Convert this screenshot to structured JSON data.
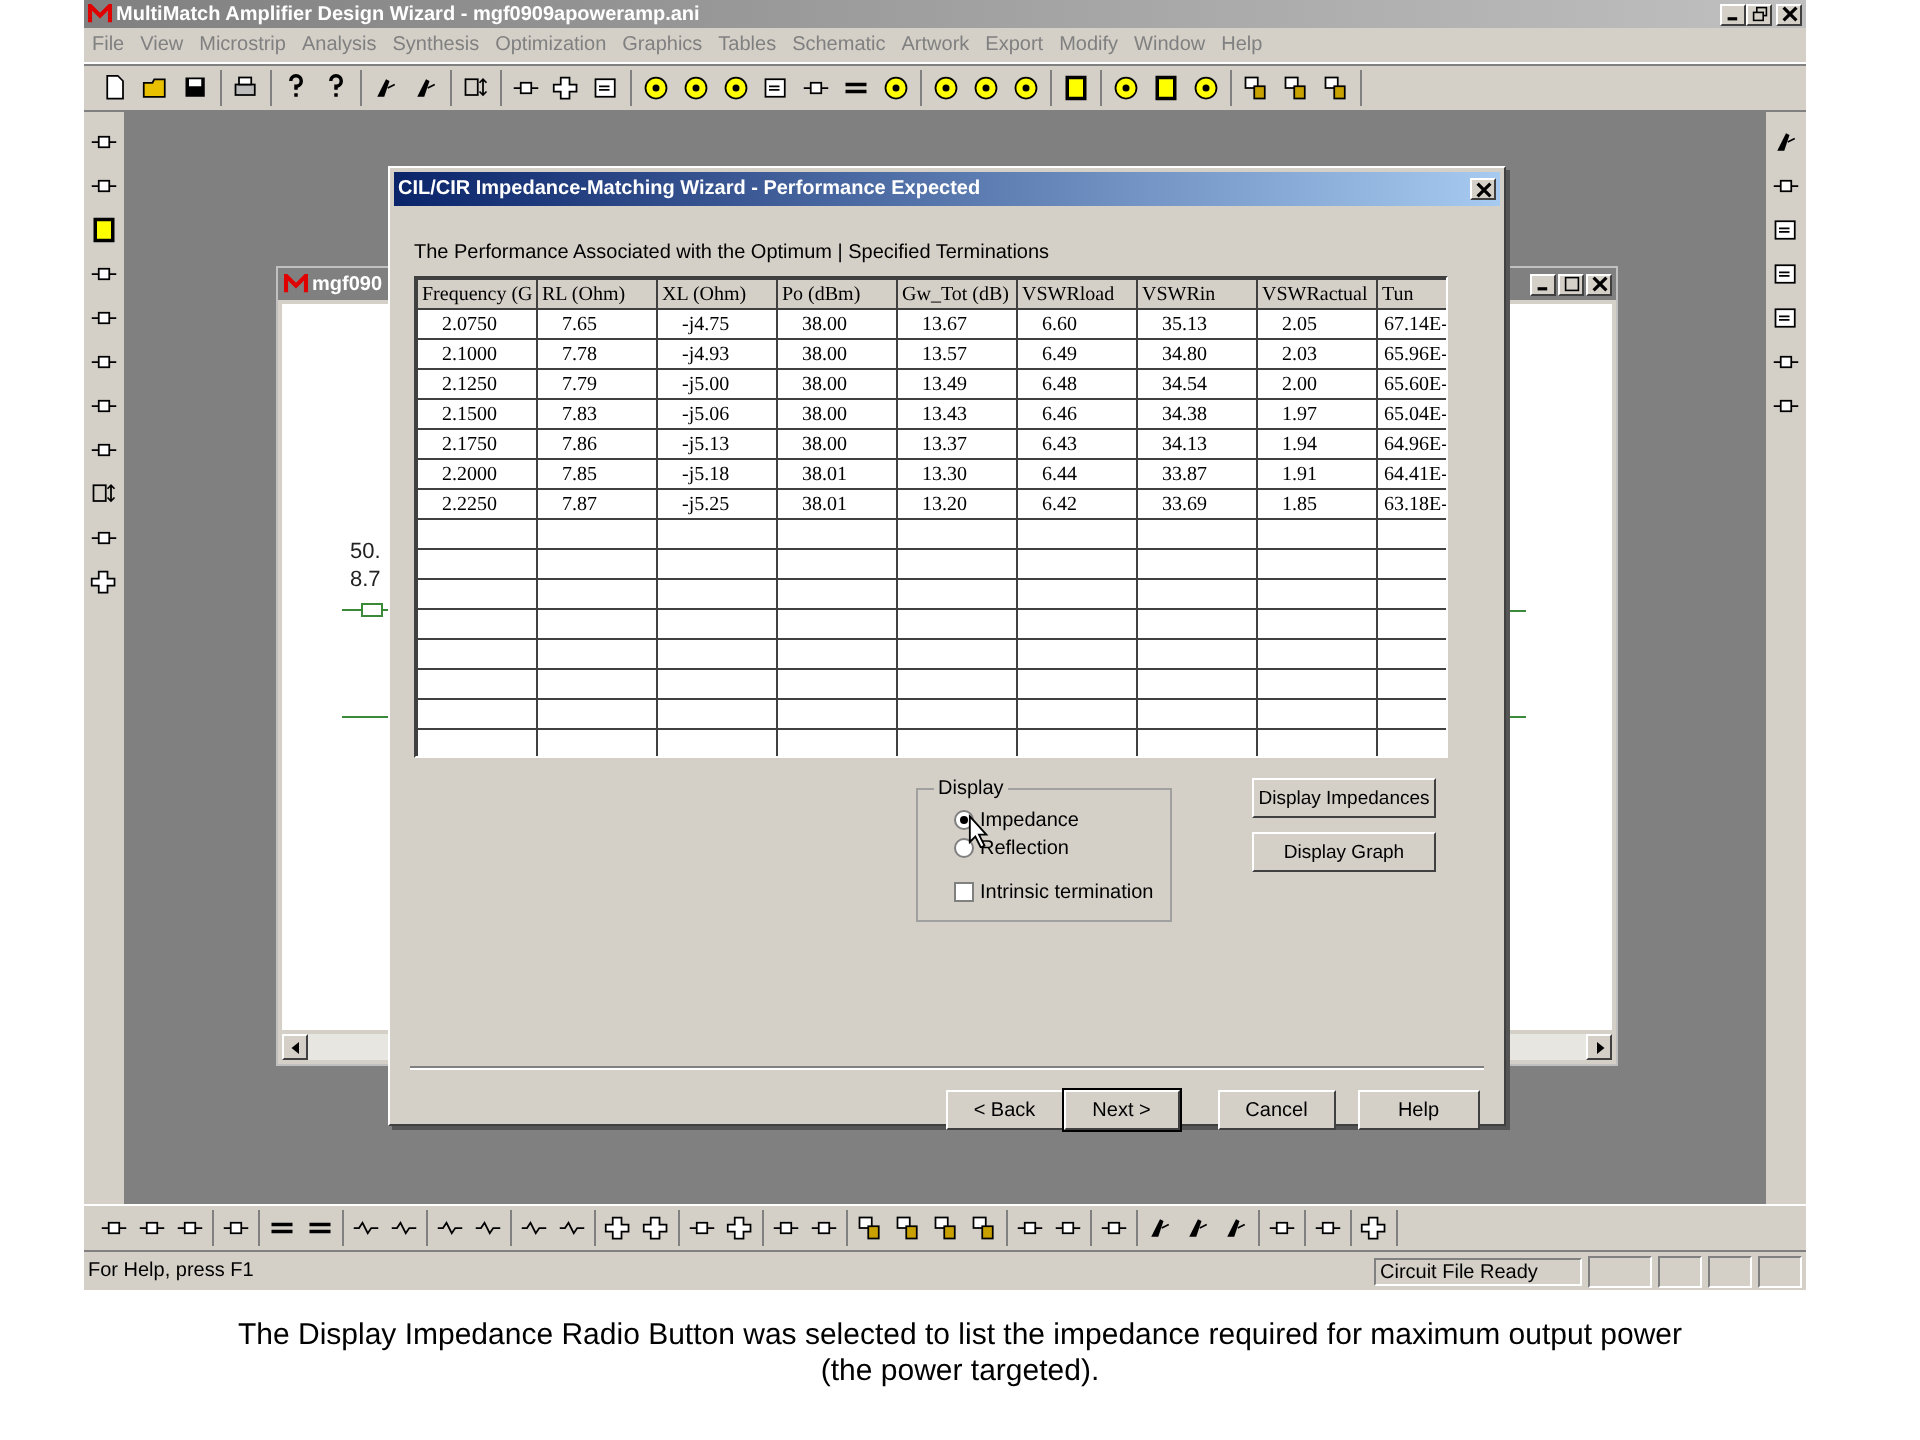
{
  "app": {
    "title": "MultiMatch Amplifier Design Wizard - mgf0909apoweramp.ani"
  },
  "menu": [
    "File",
    "View",
    "Microstrip",
    "Analysis",
    "Synthesis",
    "Optimization",
    "Graphics",
    "Tables",
    "Schematic",
    "Artwork",
    "Export",
    "Modify",
    "Window",
    "Help"
  ],
  "child_window": {
    "title": "mgf090",
    "labels": [
      "50.",
      "8.7"
    ]
  },
  "dialog": {
    "title": "CIL/CIR Impedance-Matching Wizard - Performance Expected",
    "heading": "The Performance Associated with the Optimum | Specified Terminations",
    "table": {
      "columns": [
        "Frequency (G",
        "RL (Ohm)",
        "XL (Ohm)",
        "Po (dBm)",
        "Gw_Tot (dB)",
        "VSWRload",
        "VSWRin",
        "VSWRactual",
        "Tun"
      ],
      "rows": [
        [
          "2.0750",
          "7.65",
          "-j4.75",
          "38.00",
          "13.67",
          "6.60",
          "35.13",
          "2.05",
          "67.14E-"
        ],
        [
          "2.1000",
          "7.78",
          "-j4.93",
          "38.00",
          "13.57",
          "6.49",
          "34.80",
          "2.03",
          "65.96E-"
        ],
        [
          "2.1250",
          "7.79",
          "-j5.00",
          "38.00",
          "13.49",
          "6.48",
          "34.54",
          "2.00",
          "65.60E-"
        ],
        [
          "2.1500",
          "7.83",
          "-j5.06",
          "38.00",
          "13.43",
          "6.46",
          "34.38",
          "1.97",
          "65.04E-"
        ],
        [
          "2.1750",
          "7.86",
          "-j5.13",
          "38.00",
          "13.37",
          "6.43",
          "34.13",
          "1.94",
          "64.96E-"
        ],
        [
          "2.2000",
          "7.85",
          "-j5.18",
          "38.01",
          "13.30",
          "6.44",
          "33.87",
          "1.91",
          "64.41E-"
        ],
        [
          "2.2250",
          "7.87",
          "-j5.25",
          "38.01",
          "13.20",
          "6.42",
          "33.69",
          "1.85",
          "63.18E-"
        ]
      ]
    },
    "display_group": {
      "label": "Display",
      "options": [
        {
          "label": "Impedance",
          "selected": true
        },
        {
          "label": "Reflection",
          "selected": false
        }
      ],
      "intrinsic": {
        "label": "Intrinsic termination",
        "checked": false
      }
    },
    "side_buttons": [
      "Display Impedances",
      "Display Graph"
    ],
    "buttons": [
      "< Back",
      "Next >",
      "Cancel",
      "Help"
    ]
  },
  "status_bar": {
    "help": "For Help, press F1",
    "status": "Circuit File Ready"
  },
  "caption": "The Display Impedance Radio Button was selected to list the impedance required for maximum output power (the power targeted)."
}
